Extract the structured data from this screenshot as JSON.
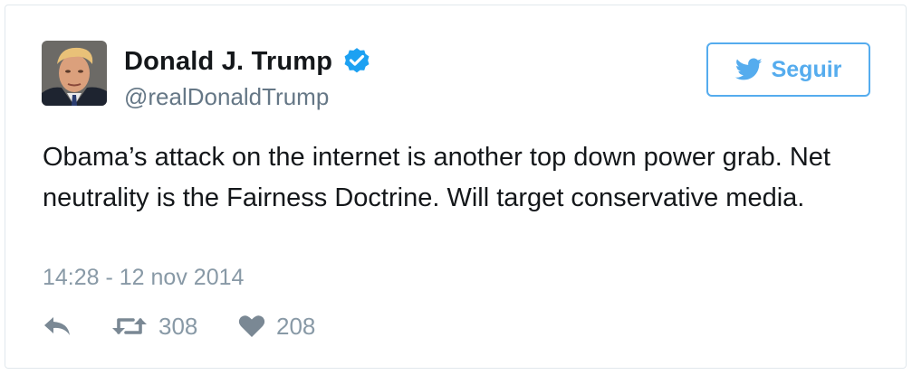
{
  "tweet": {
    "author": {
      "name": "Donald J. Trump",
      "handle": "@realDonaldTrump",
      "verified": true,
      "avatar_icon": "profile-photo"
    },
    "follow_button": {
      "label": "Seguir",
      "icon": "twitter-bird-icon"
    },
    "text": "Obama’s attack on the internet is another top down power grab. Net neutrality is the Fairness Doctrine. Will target conservative media.",
    "timestamp": "14:28 - 12 nov 2014",
    "actions": {
      "reply": {
        "icon": "reply-icon"
      },
      "retweet": {
        "icon": "retweet-icon",
        "count": "308"
      },
      "like": {
        "icon": "heart-icon",
        "count": "208"
      }
    }
  },
  "colors": {
    "accent": "#55acee",
    "verified": "#1da1f2",
    "text_primary": "#14171a",
    "text_secondary": "#657786",
    "muted": "#8899a6",
    "border": "#e1e8ed"
  }
}
